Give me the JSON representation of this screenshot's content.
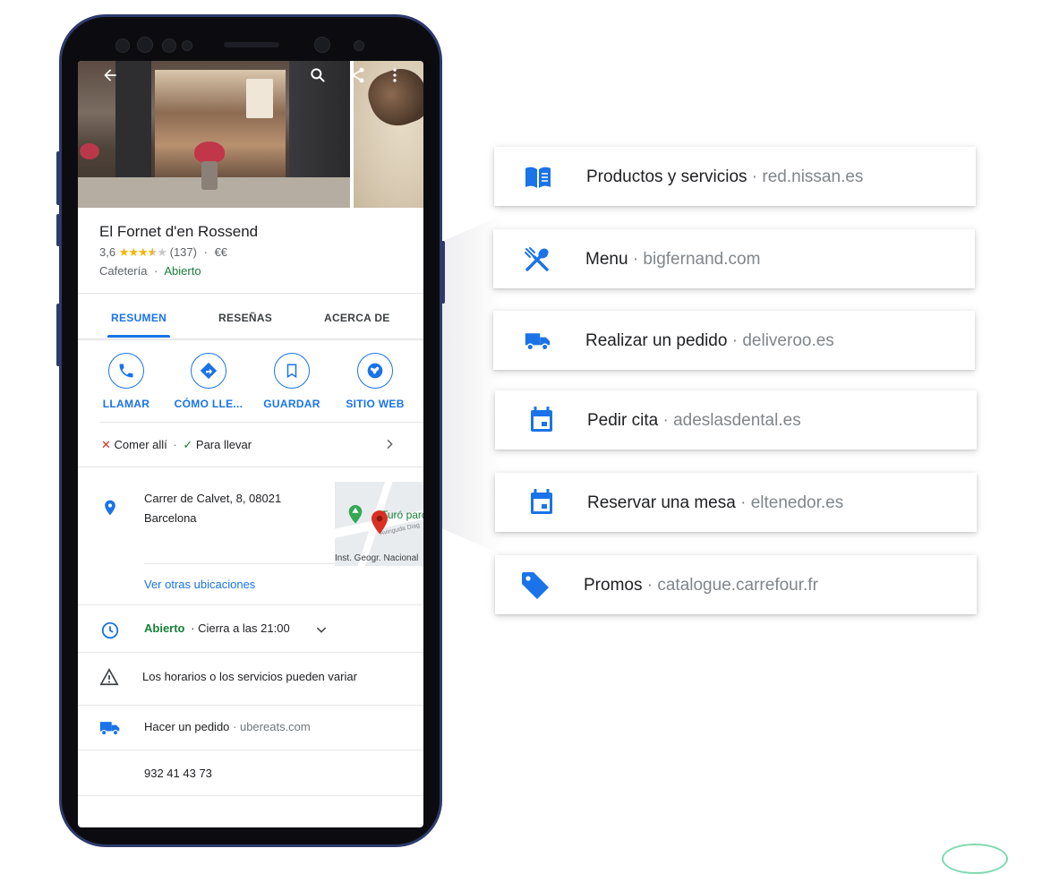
{
  "phone": {
    "place": {
      "name": "El Fornet d'en Rossend",
      "rating": "3,6",
      "review_count": "(137)",
      "price": "€€",
      "category": "Cafetería",
      "status": "Abierto",
      "separator": "·"
    },
    "tabs": [
      {
        "label": "RESUMEN",
        "active": true
      },
      {
        "label": "RESEÑAS",
        "active": false
      },
      {
        "label": "ACERCA DE",
        "active": false
      }
    ],
    "actions": [
      {
        "label": "LLAMAR",
        "icon": "phone-icon"
      },
      {
        "label": "CÓMO LLE...",
        "icon": "directions-icon"
      },
      {
        "label": "GUARDAR",
        "icon": "bookmark-icon"
      },
      {
        "label": "SITIO WEB",
        "icon": "globe-icon"
      }
    ],
    "service_options": {
      "dine_in": "Comer allí",
      "takeaway": "Para llevar",
      "separator": "·"
    },
    "address": {
      "line1": "Carrer de Calvet, 8, 08021",
      "line2": "Barcelona",
      "other_locations": "Ver otras ubicaciones"
    },
    "map": {
      "park_label": "Turó parc",
      "avenue_label": "Avinguda Diag",
      "institute_label": "Inst. Geogr. Nacional"
    },
    "hours": {
      "status": "Abierto",
      "closes": "· Cierra a las 21:00"
    },
    "warning": "Los horarios o los servicios pueden variar",
    "order": {
      "label": "Hacer un pedido",
      "domain": "· ubereats.com"
    },
    "phone_number": "932 41 43 73"
  },
  "cards": [
    {
      "label": "Productos y servicios",
      "domain": "red.nissan.es",
      "icon": "book-icon"
    },
    {
      "label": "Menu",
      "domain": "bigfernand.com",
      "icon": "utensils-icon"
    },
    {
      "label": "Realizar un pedido",
      "domain": "deliveroo.es",
      "icon": "truck-icon"
    },
    {
      "label": "Pedir cita",
      "domain": "adeslasdental.es",
      "icon": "calendar-icon"
    },
    {
      "label": "Reservar una mesa",
      "domain": "eltenedor.es",
      "icon": "calendar-icon"
    },
    {
      "label": "Promos",
      "domain": "catalogue.carrefour.fr",
      "icon": "tag-icon"
    }
  ],
  "colors": {
    "accent": "#1a73e8",
    "open_green": "#188038",
    "star": "#f6b400",
    "close_red": "#d93025",
    "phone_frame": "#2d3a6b"
  }
}
